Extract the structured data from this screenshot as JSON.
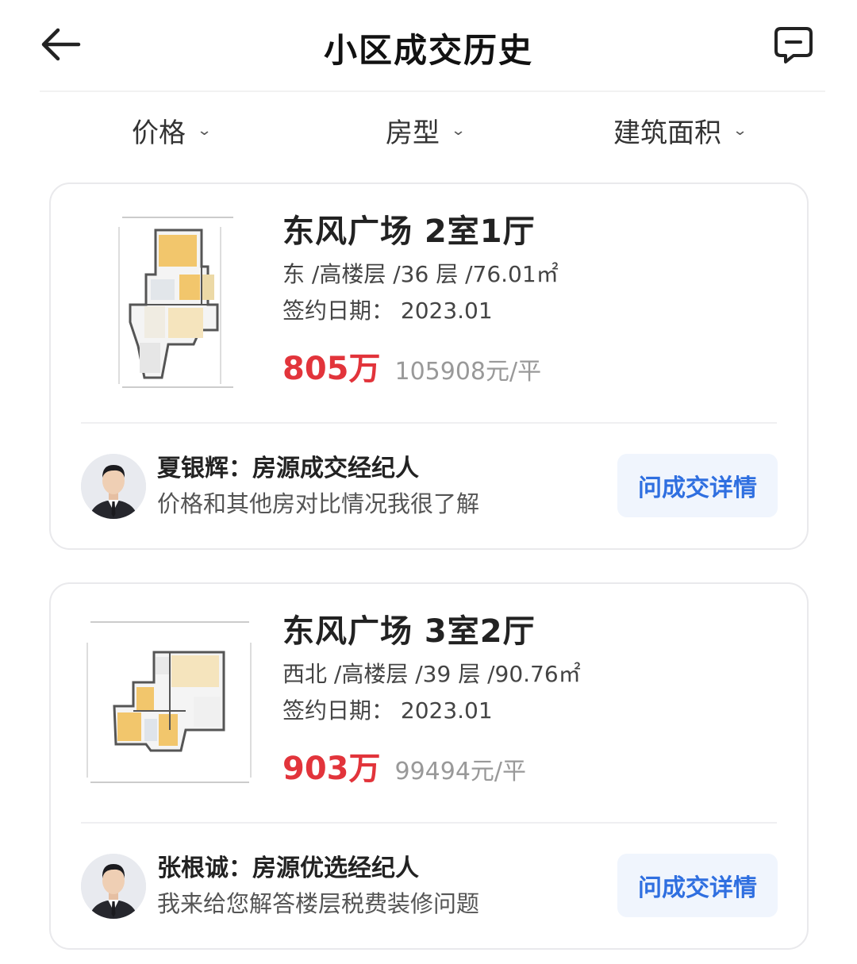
{
  "header": {
    "title": "小区成交历史"
  },
  "filters": [
    {
      "label": "价格"
    },
    {
      "label": "房型"
    },
    {
      "label": "建筑面积"
    }
  ],
  "listings": [
    {
      "title": "东风广场 2室1厅",
      "meta": "东 /高楼层 /36 层 /76.01㎡",
      "sign_date": "签约日期：  2023.01",
      "price": "805万",
      "unit_price": "105908元/平",
      "agent": {
        "name_role": "夏银辉：房源成交经纪人",
        "slogan": "价格和其他房对比情况我很了解",
        "button": "问成交详情"
      }
    },
    {
      "title": "东风广场 3室2厅",
      "meta": "西北 /高楼层 /39 层 /90.76㎡",
      "sign_date": "签约日期：  2023.01",
      "price": "903万",
      "unit_price": "99494元/平",
      "agent": {
        "name_role": "张根诚：房源优选经纪人",
        "slogan": "我来给您解答楼层税费装修问题",
        "button": "问成交详情"
      }
    }
  ],
  "colors": {
    "price": "#e2343b",
    "accent": "#2f6fe0",
    "button_bg": "#f0f5fd"
  },
  "icons": [
    "back-arrow-icon",
    "message-icon",
    "chevron-down-icon",
    "floor-plan-image",
    "agent-avatar"
  ]
}
